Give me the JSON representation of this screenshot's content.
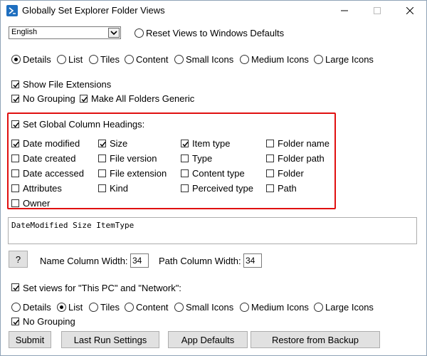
{
  "window": {
    "title": "Globally Set Explorer Folder Views",
    "controls": [
      "minimize",
      "maximize",
      "close"
    ]
  },
  "language": {
    "selected": "English"
  },
  "reset_radio": {
    "label": "Reset Views to Windows Defaults",
    "checked": false
  },
  "view_options": {
    "selected": "Details",
    "options": [
      "Details",
      "List",
      "Tiles",
      "Content",
      "Small Icons",
      "Medium Icons",
      "Large Icons"
    ]
  },
  "options": {
    "show_file_extensions": {
      "label": "Show File Extensions",
      "checked": true
    },
    "no_grouping": {
      "label": "No Grouping",
      "checked": true
    },
    "make_generic": {
      "label": "Make All Folders Generic",
      "checked": true
    }
  },
  "columns": {
    "heading_label": "Set Global Column Headings:",
    "heading_checked": true,
    "items": [
      {
        "label": "Date modified",
        "checked": true
      },
      {
        "label": "Date created",
        "checked": false
      },
      {
        "label": "Date accessed",
        "checked": false
      },
      {
        "label": "Attributes",
        "checked": false
      },
      {
        "label": "Owner",
        "checked": false
      },
      {
        "label": "Size",
        "checked": true
      },
      {
        "label": "File version",
        "checked": false
      },
      {
        "label": "File extension",
        "checked": false
      },
      {
        "label": "Kind",
        "checked": false
      },
      {
        "label": "Item type",
        "checked": true
      },
      {
        "label": "Type",
        "checked": false
      },
      {
        "label": "Content type",
        "checked": false
      },
      {
        "label": "Perceived type",
        "checked": false
      },
      {
        "label": "Folder name",
        "checked": false
      },
      {
        "label": "Folder path",
        "checked": false
      },
      {
        "label": "Folder",
        "checked": false
      },
      {
        "label": "Path",
        "checked": false
      }
    ]
  },
  "columns_text": "DateModified Size ItemType",
  "help_button": "?",
  "widths": {
    "name_label": "Name Column Width:",
    "name_value": "34",
    "path_label": "Path Column Width:",
    "path_value": "34"
  },
  "thispc": {
    "label": "Set views for \"This PC\" and \"Network\":",
    "checked": true,
    "selected": "List",
    "options": [
      "Details",
      "List",
      "Tiles",
      "Content",
      "Small Icons",
      "Medium Icons",
      "Large Icons"
    ],
    "no_grouping": {
      "label": "No Grouping",
      "checked": true
    }
  },
  "buttons": {
    "submit": "Submit",
    "last_run": "Last Run Settings",
    "app_defaults": "App Defaults",
    "restore": "Restore from Backup"
  }
}
